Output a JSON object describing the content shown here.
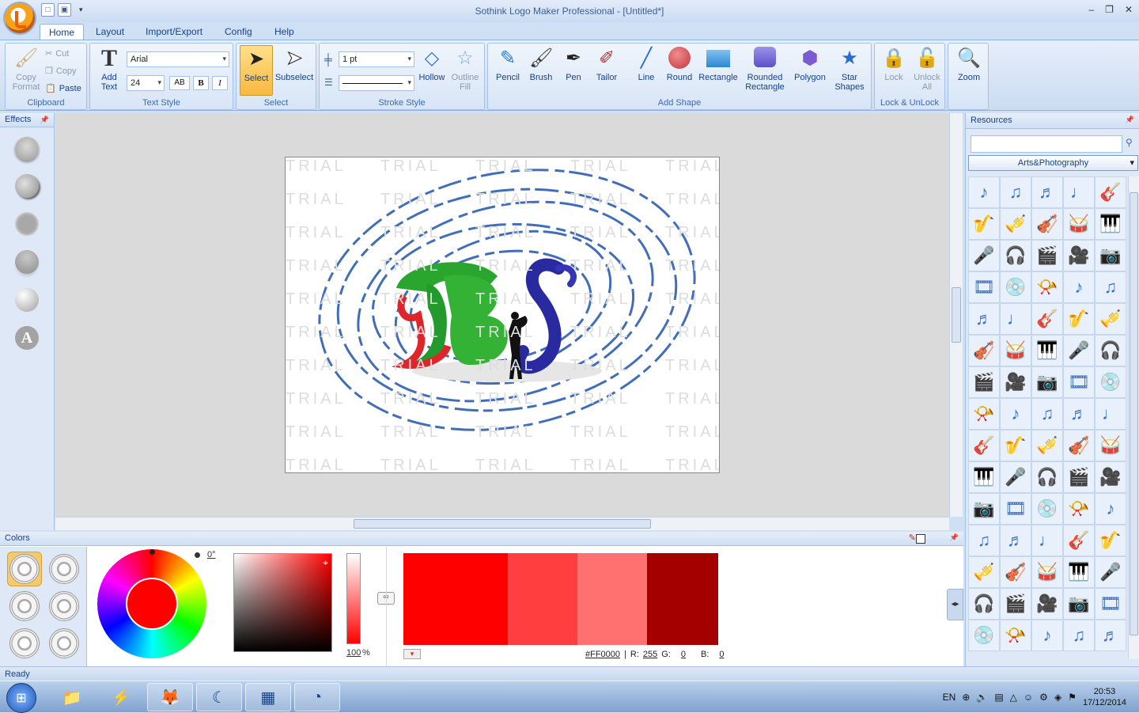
{
  "window": {
    "title": "Sothink Logo Maker Professional - [Untitled*]"
  },
  "tabs": [
    "Home",
    "Layout",
    "Import/Export",
    "Config",
    "Help"
  ],
  "ribbon": {
    "clipboard": {
      "label": "Clipboard",
      "copy_format": "Copy Format",
      "cut": "Cut",
      "copy": "Copy",
      "paste": "Paste"
    },
    "text_style": {
      "label": "Text Style",
      "add_text": "Add Text",
      "font": "Arial",
      "size": "24",
      "bold": "B",
      "italic": "I",
      "spacing": "AB"
    },
    "select": {
      "label": "Select",
      "select": "Select",
      "subselect": "Subselect"
    },
    "stroke_style": {
      "label": "Stroke Style",
      "width": "1 pt",
      "hollow": "Hollow",
      "outline_fill": "Outline Fill"
    },
    "add_shape": {
      "label": "Add Shape",
      "pencil": "Pencil",
      "brush": "Brush",
      "pen": "Pen",
      "tailor": "Tailor",
      "line": "Line",
      "round": "Round",
      "rectangle": "Rectangle",
      "rounded_rectangle": "Rounded Rectangle",
      "polygon": "Polygon",
      "star_shapes": "Star Shapes"
    },
    "lock": {
      "label": "Lock & UnLock",
      "lock": "Lock",
      "unlock_all": "Unlock All"
    },
    "zoom": {
      "label": "Zoom"
    }
  },
  "effects_panel": {
    "title": "Effects",
    "text_effect_glyph": "A"
  },
  "canvas": {
    "watermark": "TRIAL",
    "logo_letters": "BS"
  },
  "colors_panel": {
    "title": "Colors",
    "angle": "0°",
    "opacity": "100",
    "opacity_unit": "%",
    "hex": "#FF0000",
    "r_label": "R:",
    "r": "255",
    "g_label": "G:",
    "g": "0",
    "b_label": "B:",
    "b": "0",
    "swatches": [
      "#ff0000",
      "#ff3f3f",
      "#ff7070",
      "#a50000"
    ]
  },
  "resources": {
    "title": "Resources",
    "category": "Arts&Photography"
  },
  "status": {
    "text": "Ready"
  },
  "taskbar": {
    "lang": "EN",
    "time": "20:53",
    "date": "17/12/2014"
  }
}
